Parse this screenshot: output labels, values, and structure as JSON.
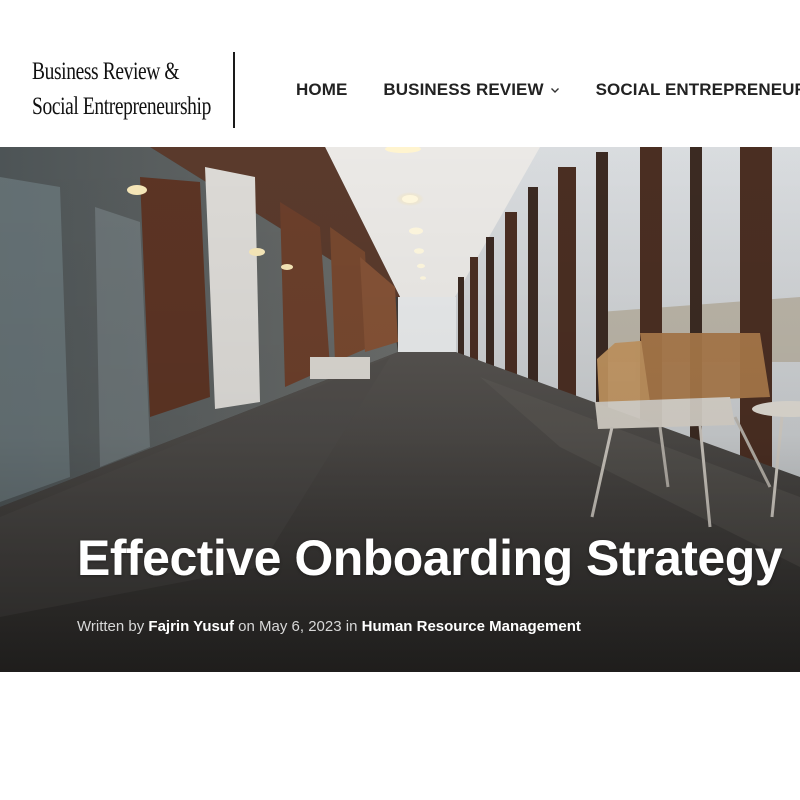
{
  "site": {
    "logo_line1": "Business Review &",
    "logo_line2": "Social Entrepreneurship"
  },
  "nav": {
    "items": [
      {
        "label": "HOME"
      },
      {
        "label": "BUSINESS REVIEW",
        "icon": "chevron-down-icon"
      },
      {
        "label": "SOCIAL ENTREPRENEURSHIP"
      }
    ]
  },
  "post": {
    "title": "Effective Onboarding Strategy",
    "meta": {
      "written_by": "Written by",
      "author": "Fajrin Yusuf",
      "on": "on",
      "date": "May 6, 2023",
      "in": "in",
      "category": "Human Resource Management"
    }
  },
  "colors": {
    "header_bg": "#ffffff",
    "text_dark": "#222222",
    "title_text": "#ffffff"
  }
}
